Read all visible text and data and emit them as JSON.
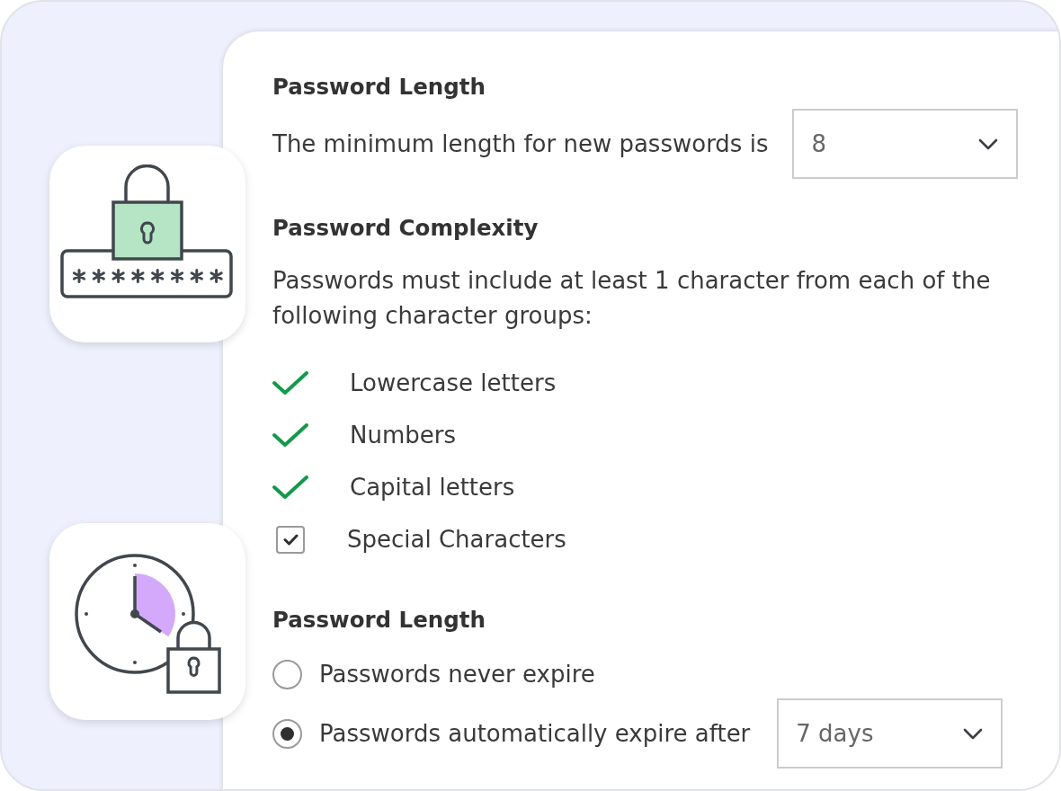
{
  "sections": [
    {
      "kind": "select_row",
      "heading": "Password Length",
      "label": "The minimum length for new passwords is",
      "select": {
        "value": "8"
      }
    },
    {
      "kind": "requirements",
      "heading": "Password Complexity",
      "description": "Passwords must include at least 1 character from each of the following character groups:",
      "items": [
        {
          "kind": "tick",
          "label": "Lowercase letters",
          "checked": true
        },
        {
          "kind": "tick",
          "label": "Numbers",
          "checked": true
        },
        {
          "kind": "tick",
          "label": "Capital letters",
          "checked": true
        },
        {
          "kind": "checkbox",
          "label": "Special Characters",
          "checked": true
        }
      ]
    },
    {
      "kind": "radio_group",
      "heading": "Password Length",
      "options": [
        {
          "label": "Passwords never expire",
          "selected": false
        },
        {
          "label": "Passwords automatically expire after",
          "selected": true,
          "select": {
            "value": "7 days"
          }
        }
      ]
    }
  ]
}
